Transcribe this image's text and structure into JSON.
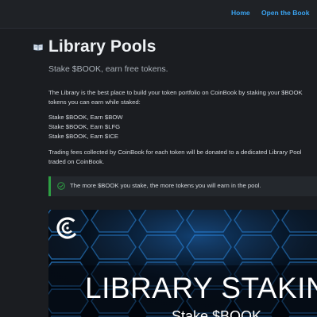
{
  "nav": {
    "home_label": "Home",
    "book_label": "Open the Book"
  },
  "header": {
    "title": "Library Pools",
    "subtitle": "Stake $BOOK, earn free tokens.",
    "icon": "open-book-icon"
  },
  "content": {
    "intro_line1": "The Library is the best place to build your token portfolio on CoinBook by staking your $BOOK",
    "intro_line2": "tokens you can earn while staked:",
    "rewards": [
      "Stake $BOOK, Earn $BOW",
      "Stake $BOOK, Earn $LFG",
      "Stake $BOOK, Earn $ICE"
    ],
    "fees_line1": "Trading fees collected by CoinBook for each token will be donated to a dedicated Library Pool",
    "fees_line2": "traded on CoinBook."
  },
  "callout": {
    "text": "The more $BOOK you stake, the more tokens you will earn in the pool.",
    "icon": "check-circle-icon",
    "accent": "#2ea043"
  },
  "banner": {
    "title": "LIBRARY STAKING",
    "subtitle": "Stake $BOOK",
    "logo": "coinbook-logo-icon"
  },
  "colors": {
    "background": "#1b1d21",
    "link": "#3aa3f0",
    "banner_glow": "#2d8fe6"
  }
}
